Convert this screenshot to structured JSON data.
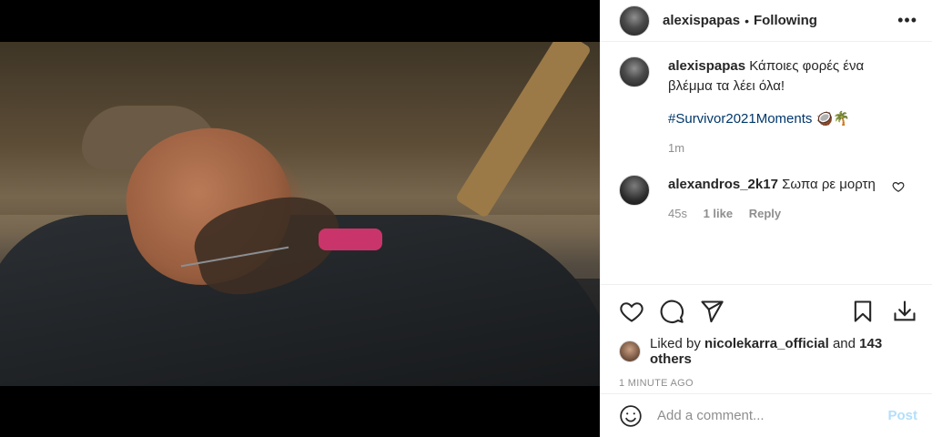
{
  "post": {
    "username": "alexispapas",
    "follow_status": "Following",
    "caption_text": "Κάποιες φορές ένα βλέμμα τα λέει όλα!",
    "hashtag": "#Survivor2021Moments",
    "emojis": "🥥🌴",
    "caption_time": "1m"
  },
  "comments": [
    {
      "username": "alexandros_2k17",
      "text": "Σωπα ρε μορτη",
      "time": "45s",
      "likes": "1 like",
      "reply": "Reply"
    }
  ],
  "likes": {
    "prefix": "Liked by",
    "user": "nicolekarra_official",
    "and": "and",
    "others": "143 others"
  },
  "timestamp": "1 MINUTE AGO",
  "add_comment": {
    "placeholder": "Add a comment...",
    "post_label": "Post"
  },
  "icons": {
    "more": "more-options-icon",
    "like": "heart-icon",
    "comment": "comment-icon",
    "share": "share-icon",
    "save": "bookmark-icon",
    "download": "download-icon",
    "emoji": "emoji-icon"
  },
  "colors": {
    "hashtag": "#00376b",
    "muted": "#8e8e8e",
    "post_button": "#b2dffc",
    "border": "#efefef"
  }
}
